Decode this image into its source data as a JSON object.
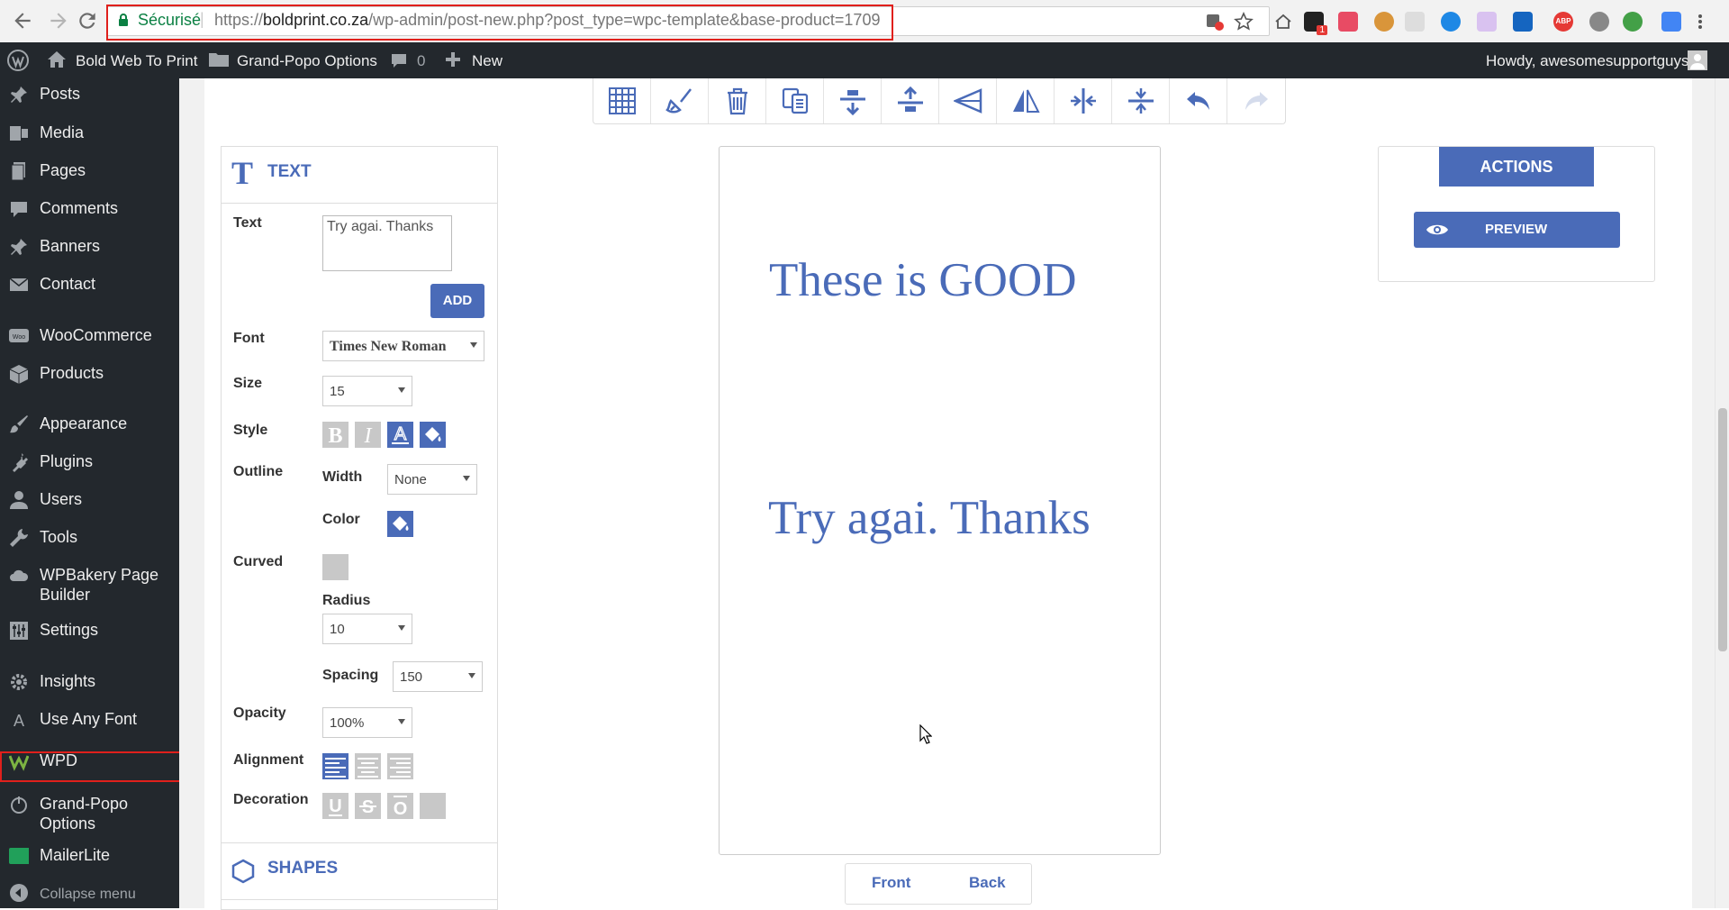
{
  "browser": {
    "secure_label": "Sécurisé",
    "url_scheme": "https://",
    "url_host": "boldprint.co.za",
    "url_path": "/wp-admin/post-new.php?post_type=wpc-template&base-product=1709",
    "ext_badge": "1",
    "abp_label": "ABP"
  },
  "adminbar": {
    "site_name": "Bold Web To Print",
    "options_label": "Grand-Popo Options",
    "comments_count": "0",
    "new_label": "New",
    "howdy": "Howdy, awesomesupportguys"
  },
  "sidebar": {
    "items": [
      {
        "label": "Posts",
        "icon": "pushpin-icon"
      },
      {
        "label": "Media",
        "icon": "media-icon"
      },
      {
        "label": "Pages",
        "icon": "pages-icon"
      },
      {
        "label": "Comments",
        "icon": "comments-icon"
      },
      {
        "label": "Banners",
        "icon": "pushpin-icon"
      },
      {
        "label": "Contact",
        "icon": "mail-icon"
      },
      {
        "label": "WooCommerce",
        "icon": "woo-icon"
      },
      {
        "label": "Products",
        "icon": "box-icon"
      },
      {
        "label": "Appearance",
        "icon": "brush-icon"
      },
      {
        "label": "Plugins",
        "icon": "plug-icon"
      },
      {
        "label": "Users",
        "icon": "user-icon"
      },
      {
        "label": "Tools",
        "icon": "wrench-icon"
      },
      {
        "label": "WPBakery Page",
        "label2": "Builder",
        "icon": "cloud-icon"
      },
      {
        "label": "Settings",
        "icon": "sliders-icon"
      },
      {
        "label": "Insights",
        "icon": "gear-icon"
      },
      {
        "label": "Use Any Font",
        "icon": "font-a-icon"
      },
      {
        "label": "WPD",
        "icon": "wpd-logo-icon"
      },
      {
        "label": "Grand-Popo",
        "label2": "Options",
        "icon": "power-icon"
      },
      {
        "label": "MailerLite",
        "icon": "mailerlite-icon"
      },
      {
        "label": "Collapse menu",
        "icon": "collapse-icon"
      }
    ]
  },
  "text_panel": {
    "title": "TEXT",
    "text_label": "Text",
    "text_value": "Try agai. Thanks",
    "add_label": "ADD",
    "font_label": "Font",
    "font_value": "Times New Roman",
    "size_label": "Size",
    "size_value": "15",
    "style_label": "Style",
    "outline_label": "Outline",
    "width_label": "Width",
    "width_value": "None",
    "color_label": "Color",
    "curved_label": "Curved",
    "radius_label": "Radius",
    "radius_value": "10",
    "spacing_label": "Spacing",
    "spacing_value": "150",
    "opacity_label": "Opacity",
    "opacity_value": "100%",
    "alignment_label": "Alignment",
    "decoration_label": "Decoration"
  },
  "shapes_panel": {
    "title": "SHAPES"
  },
  "canvas": {
    "text1": "These is GOOD",
    "text2": "Try agai. Thanks",
    "front_label": "Front",
    "back_label": "Back"
  },
  "actions": {
    "title": "ACTIONS",
    "preview_label": "PREVIEW"
  },
  "colors": {
    "accent": "#4a6bb8",
    "admin_bg": "#23282d",
    "highlight": "#e0201c"
  }
}
